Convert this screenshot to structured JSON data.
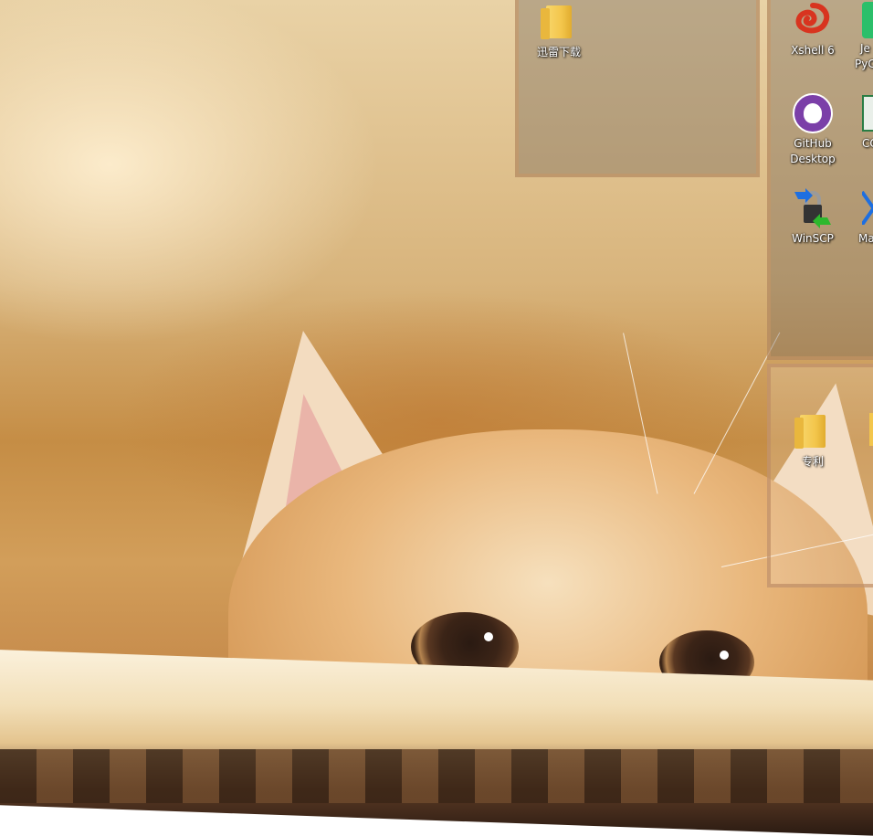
{
  "desktop": {
    "icons": [
      {
        "id": "xunlei",
        "label": "迅雷下载",
        "icon": "folder-icon"
      },
      {
        "id": "xshell",
        "label": "Xshell 6",
        "icon": "xshell-icon"
      },
      {
        "id": "github",
        "label": "GitHub Desktop",
        "icon": "github-icon"
      },
      {
        "id": "winscp",
        "label": "WinSCP",
        "icon": "winscp-icon"
      },
      {
        "id": "zhuanli",
        "label": "专利",
        "icon": "folder-icon"
      }
    ],
    "partial_labels": [
      "Je",
      "PyC",
      "CC",
      "Ma"
    ]
  },
  "colors": {
    "folder": "#f3c64c",
    "github_purple": "#7b3fa8",
    "xshell_red": "#d8341f"
  }
}
